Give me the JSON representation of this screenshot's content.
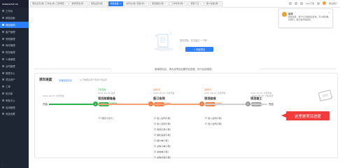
{
  "brand": {
    "name": "WORKSHOP OS"
  },
  "sidebar": {
    "items": [
      {
        "label": "工作台"
      },
      {
        "label": "销售线索"
      },
      {
        "label": "项目协同"
      },
      {
        "label": "客户管理"
      },
      {
        "label": "采购管理"
      },
      {
        "label": "库存管理"
      },
      {
        "label": "财务管理"
      },
      {
        "label": "人事管理"
      },
      {
        "label": "合同管理"
      },
      {
        "label": "报表中心"
      },
      {
        "label": "项目资产"
      },
      {
        "label": "工单"
      },
      {
        "label": "知识库"
      },
      {
        "label": "审批中心"
      },
      {
        "label": "应用管理"
      },
      {
        "label": "系统设置"
      }
    ],
    "active_index": 2,
    "collapse_label": "‹"
  },
  "tabs": [
    {
      "label": "项目主页(测)-工作台(测)-工作项目"
    },
    {
      "label": "新增项目(测)"
    },
    {
      "label": "项目设定(测)"
    },
    {
      "label": "项目进度"
    },
    {
      "label": "资讯台(测)-项目(测)"
    },
    {
      "label": "项目报表(测)"
    },
    {
      "label": "工作任务(测)"
    },
    {
      "label": "项目下达"
    },
    {
      "label": "客户总结(测)"
    }
  ],
  "active_tab": 3,
  "topbar": {
    "app_label": "App下载",
    "user_label": "测试用户"
  },
  "empty_state": {
    "text": "暂无项目，先去建立一个吧~",
    "button": "+ 新建项目"
  },
  "notice": "新增项目后，请为该项目创建项目进度，执行后续推进。",
  "progress_card": {
    "title": "项目进度",
    "link": "管理项目阶段",
    "hint": "以下数据来源于项目计划设置",
    "stamp": "样例",
    "start_label": "开始",
    "end_label": "完结",
    "start_date": "2021-09-15 计划开始",
    "end_date": "2021-09-15 计划完成",
    "stages": [
      {
        "state": "已经完成",
        "date": "2021-09-21 完成",
        "name": "项目前期准备",
        "badge": "已完成",
        "pct": "100%",
        "items": [
          "项目计划(1)"
        ],
        "color": "#2bb24c",
        "index": "1"
      },
      {
        "state": "逾期0天",
        "date": "2021-09-13 计划开始",
        "name": "签订合同",
        "badge": "进行中",
        "pct": "20%",
        "items": [
          "收入合同(1笔)",
          "收入合同(1笔)",
          "收款记录(1笔)",
          "销售提成(1笔)",
          "报价单(1笔)",
          "采购订单(1笔)",
          "验收单(1笔)",
          "采购付款(1笔)"
        ],
        "color": "#f5783a",
        "index": "2"
      },
      {
        "state": "逾期0天",
        "date": "2021-09-13 计划开始",
        "name": "项目验收",
        "badge": "进行中",
        "pct": "20%",
        "items": [
          "收入合同(1笔)",
          "收入合同(1笔)"
        ],
        "color": "#f5783a",
        "index": "3"
      },
      {
        "state": "",
        "date": "2021-09-15 计划开始",
        "name": "项目竣工",
        "badge": "待执行",
        "pct": "",
        "items": [],
        "color": "#9a9a9a",
        "index": "4"
      }
    ]
  },
  "callout": {
    "text": "这里是项目进度"
  },
  "popup": {
    "name": "客服",
    "message": "我在这里，有什么问题欢迎咨询，可以随时联系我们，我们会尽快回复。"
  }
}
